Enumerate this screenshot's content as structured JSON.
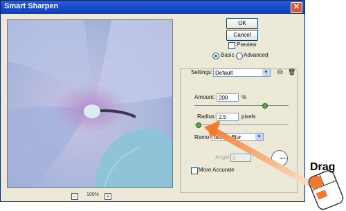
{
  "window": {
    "title": "Smart Sharpen",
    "close_symbol": "✕"
  },
  "buttons": {
    "ok": "OK",
    "cancel": "Cancel"
  },
  "preview": {
    "checkbox_label": "Preview",
    "checked": false
  },
  "mode": {
    "basic": "Basic",
    "advanced": "Advanced",
    "selected": "Basic"
  },
  "settings": {
    "label": "Settings:",
    "value": "Default"
  },
  "amount": {
    "label": "Amount:",
    "value": "200",
    "unit": "%",
    "slider_fraction": 0.74
  },
  "radius": {
    "label": "Radius:",
    "value": "2.5",
    "unit": "pixels",
    "slider_fraction": 0.04
  },
  "remove": {
    "label": "Remo",
    "value": "ussian Blur"
  },
  "angle": {
    "label": "Angle:",
    "value": "0"
  },
  "more_accurate": {
    "label": "More Accurate",
    "checked": false
  },
  "zoom": {
    "minus": "−",
    "value": "100%",
    "plus": "+"
  },
  "annotation": {
    "text": "Drag",
    "arrow_color": "#f07a30"
  }
}
